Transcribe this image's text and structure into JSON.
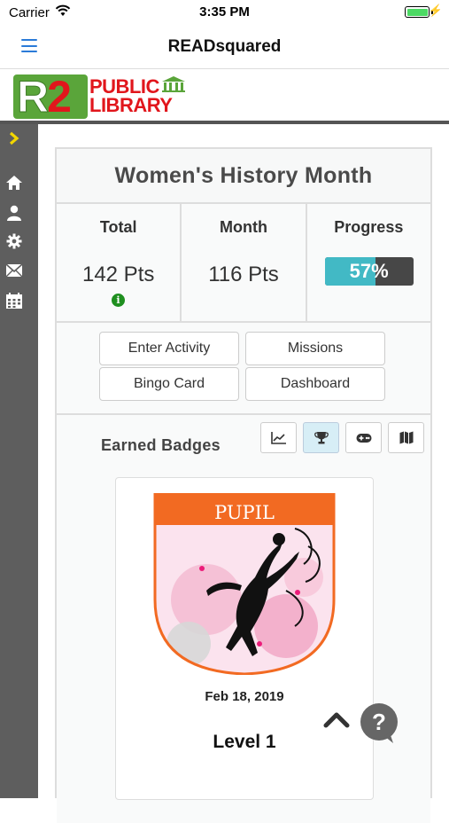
{
  "status_bar": {
    "carrier": "Carrier",
    "time": "3:35 PM"
  },
  "nav": {
    "title": "READsquared"
  },
  "logo": {
    "mark": "R2",
    "line1": "PUBLIC",
    "line2": "LIBRARY"
  },
  "sidebar": {
    "items": [
      "expand-icon",
      "home-icon",
      "user-icon",
      "gear-icon",
      "mail-icon",
      "calendar-icon"
    ]
  },
  "program": {
    "title": "Women's History Month"
  },
  "stats": {
    "total_label": "Total",
    "total_value": "142 Pts",
    "month_label": "Month",
    "month_value": "116 Pts",
    "progress_label": "Progress",
    "progress_text": "57%",
    "progress_fraction": 0.57
  },
  "actions": {
    "enter_activity": "Enter Activity",
    "missions": "Missions",
    "bingo_card": "Bingo Card",
    "dashboard": "Dashboard"
  },
  "badges": {
    "heading": "Earned Badges",
    "view_buttons": [
      "chart-icon",
      "trophy-icon",
      "gamepad-icon",
      "map-icon"
    ],
    "active_view": "trophy-icon",
    "items": [
      {
        "name": "PUPIL",
        "date": "Feb 18, 2019",
        "level": "Level 1"
      }
    ]
  },
  "colors": {
    "accent_blue": "#2b7bd8",
    "progress_fill": "#42b9c5",
    "progress_track": "#474747",
    "sidebar_bg": "#5e5e5e",
    "badge_banner": "#f26a22",
    "info_green": "#1f8f1f"
  }
}
